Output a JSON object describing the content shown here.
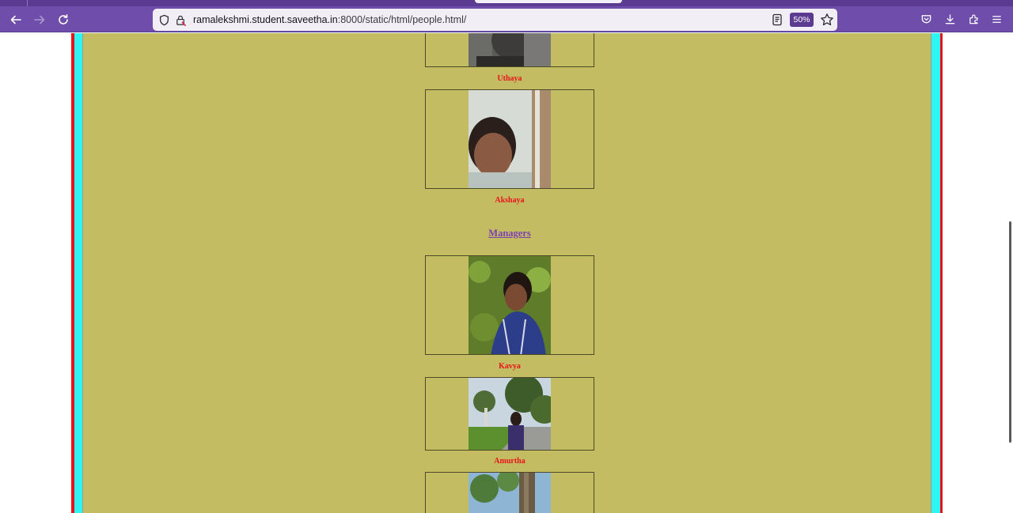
{
  "browser": {
    "url_host": "ramalekshmi.student.saveetha.in",
    "url_rest": ":8000/static/html/people.html/",
    "zoom": "50%"
  },
  "page": {
    "people_top": [
      {
        "name": "Uthaya"
      },
      {
        "name": "Akshaya"
      }
    ],
    "managers_heading": "Managers",
    "managers": [
      {
        "name": "Kavya"
      },
      {
        "name": "Amurtha"
      }
    ]
  },
  "colors": {
    "page_background": "#c3bc63",
    "name_color": "#e8141a",
    "heading_color": "#7b3fb0",
    "border_red": "#e8141a",
    "border_cyan": "#2ff5f2",
    "chrome_purple": "#6f4eab"
  }
}
